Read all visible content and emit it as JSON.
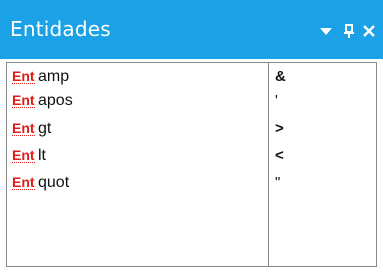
{
  "panel": {
    "title": "Entidades",
    "accent": "#1aa1e6",
    "controls": {
      "dropdown_icon": "chevron-down-icon",
      "pin_icon": "pin-icon",
      "close_icon": "close-icon"
    }
  },
  "entities": [
    {
      "badge": "Ent",
      "name": "amp",
      "value": "&"
    },
    {
      "badge": "Ent",
      "name": "apos",
      "value": "'"
    },
    {
      "badge": "Ent",
      "name": "gt",
      "value": ">"
    },
    {
      "badge": "Ent",
      "name": "lt",
      "value": "<"
    },
    {
      "badge": "Ent",
      "name": "quot",
      "value": "\""
    }
  ]
}
